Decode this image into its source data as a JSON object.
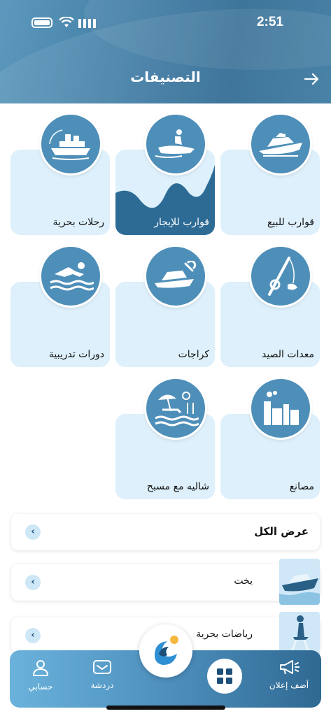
{
  "status_bar": {
    "time": "2:51"
  },
  "header": {
    "title": "التصنيفات",
    "back_icon": "arrow-right-icon"
  },
  "categories": [
    {
      "label": "قوارب للبيع",
      "icon": "yacht-icon"
    },
    {
      "label": "قوارب للإيجار",
      "icon": "jetski-icon",
      "active": true
    },
    {
      "label": "رحلات بحرية",
      "icon": "cruise-ship-icon"
    },
    {
      "label": "معدات الصيد",
      "icon": "fishing-rod-icon"
    },
    {
      "label": "كراجات",
      "icon": "boat-wrench-icon"
    },
    {
      "label": "دورات تدريبية",
      "icon": "swimmer-icon"
    },
    {
      "label": "مصانع",
      "icon": "factory-icon"
    },
    {
      "label": "شاليه مع مسبح",
      "icon": "chalet-pool-icon"
    }
  ],
  "list": {
    "view_all": "عرض الكل",
    "items": [
      {
        "label": "يخت",
        "icon": "yacht-thumb"
      },
      {
        "label": "رياضات بحرية",
        "icon": "flyboard-thumb"
      }
    ]
  },
  "bottom_nav": {
    "add_ad": "أضف إعلان",
    "chat": "دردشة",
    "account": "حسابي"
  },
  "colors": {
    "primary": "#4e8fb9",
    "card_bg": "#ddf0fb",
    "dark_blue": "#1c4e78"
  }
}
